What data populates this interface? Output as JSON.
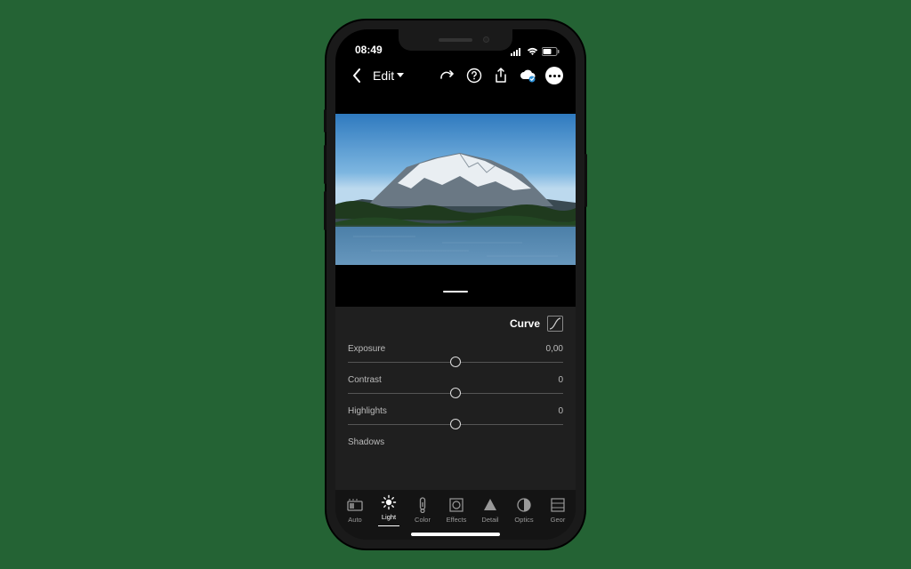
{
  "status": {
    "time": "08:49"
  },
  "toolbar": {
    "edit": "Edit"
  },
  "panel": {
    "curve_label": "Curve",
    "sliders": [
      {
        "label": "Exposure",
        "value": "0,00"
      },
      {
        "label": "Contrast",
        "value": "0"
      },
      {
        "label": "Highlights",
        "value": "0"
      },
      {
        "label": "Shadows",
        "value": ""
      }
    ]
  },
  "tabs": [
    {
      "label": "Auto"
    },
    {
      "label": "Light"
    },
    {
      "label": "Color"
    },
    {
      "label": "Effects"
    },
    {
      "label": "Detail"
    },
    {
      "label": "Optics"
    },
    {
      "label": "Geor"
    }
  ],
  "active_tab": 1
}
